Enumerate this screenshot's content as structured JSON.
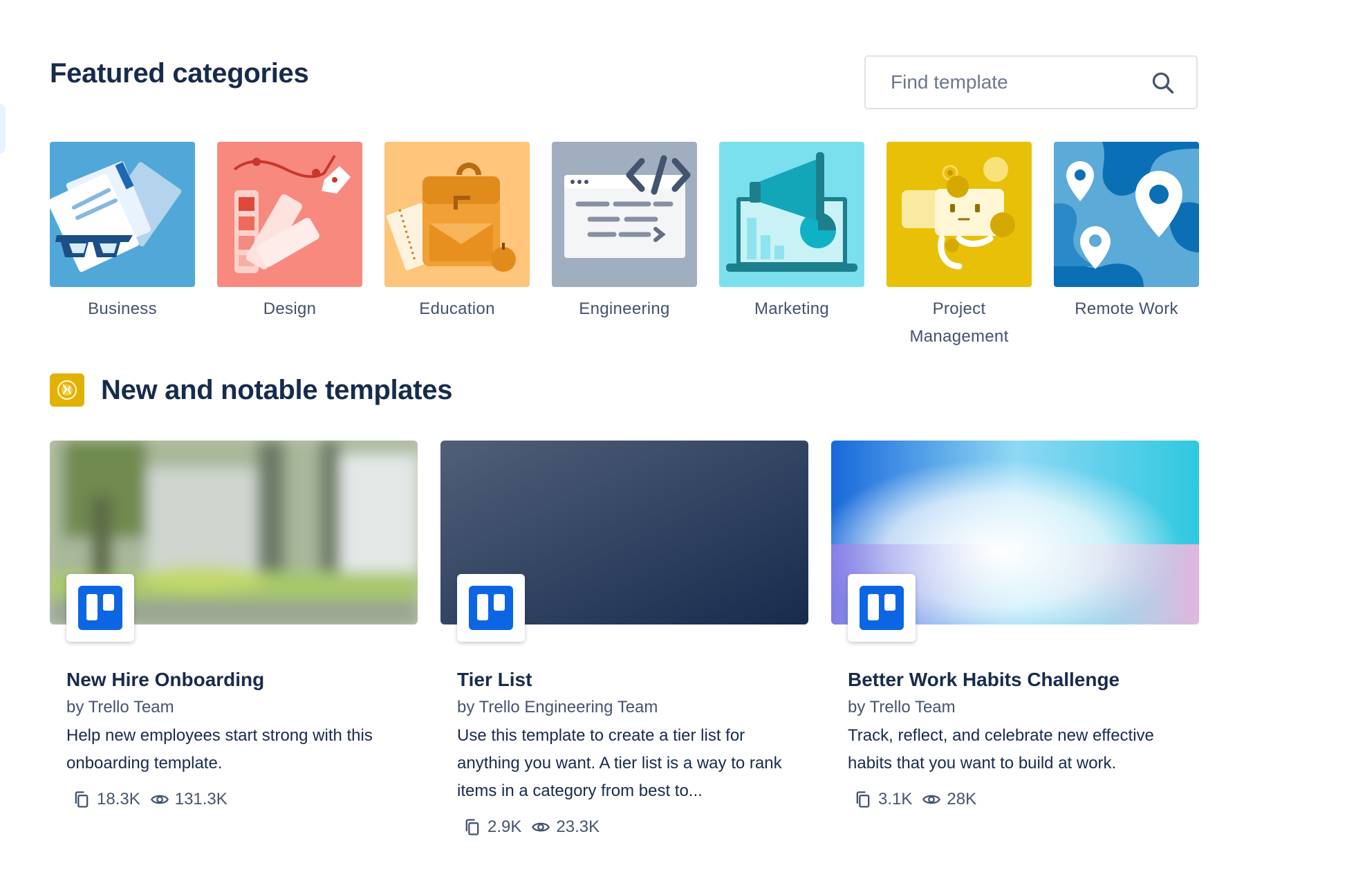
{
  "featured": {
    "title": "Featured categories",
    "search_placeholder": "Find template",
    "categories": [
      {
        "label": "Business",
        "color": "#4fa8d8"
      },
      {
        "label": "Design",
        "color": "#f8897f"
      },
      {
        "label": "Education",
        "color": "#fec57b"
      },
      {
        "label": "Engineering",
        "color": "#a1aec0"
      },
      {
        "label": "Marketing",
        "color": "#7ae0ee"
      },
      {
        "label": "Project\nManagement",
        "color": "#e8c007"
      },
      {
        "label": "Remote Work",
        "color": "#0b6fb5"
      }
    ]
  },
  "notable": {
    "title": "New and notable templates",
    "badge_color": "#e2b203",
    "cards": [
      {
        "title": "New Hire Onboarding",
        "author": "by Trello Team",
        "description": "Help new employees start strong with this onboarding template.",
        "copies": "18.3K",
        "views": "131.3K"
      },
      {
        "title": "Tier List",
        "author": "by Trello Engineering Team",
        "description": "Use this template to create a tier list for anything you want. A tier list is a way to rank items in a category from best to...",
        "copies": "2.9K",
        "views": "23.3K"
      },
      {
        "title": "Better Work Habits Challenge",
        "author": "by Trello Team",
        "description": "Track, reflect, and celebrate new effective habits that you want to build at work.",
        "copies": "3.1K",
        "views": "28K"
      }
    ]
  },
  "colors": {
    "heading": "#172b4d",
    "trello_blue": "#0c66e4"
  }
}
